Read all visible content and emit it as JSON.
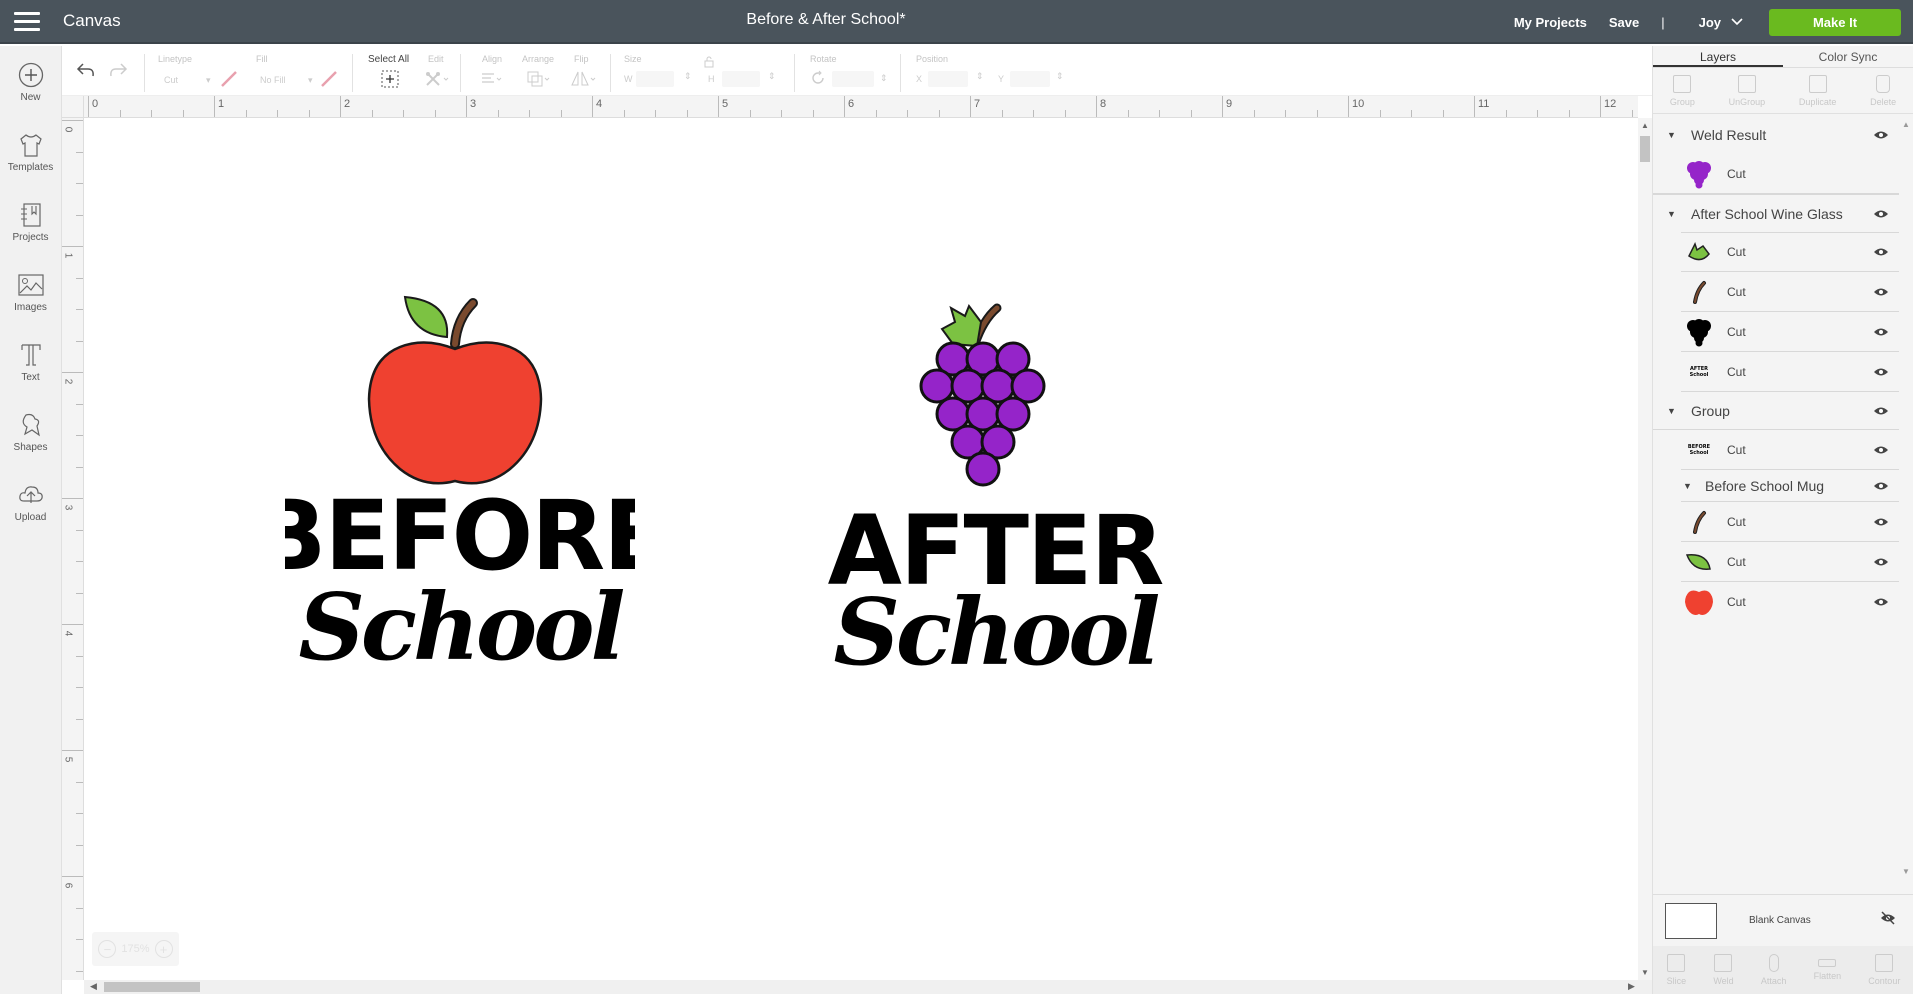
{
  "header": {
    "app_name": "Canvas",
    "document_title": "Before & After School*",
    "my_projects": "My Projects",
    "save": "Save",
    "separator": "|",
    "user": "Joy",
    "make_it": "Make It",
    "accent_color": "#6aba1f"
  },
  "left_nav": {
    "items": [
      {
        "label": "New",
        "icon": "plus-circle-icon"
      },
      {
        "label": "Templates",
        "icon": "tshirt-icon"
      },
      {
        "label": "Projects",
        "icon": "notebook-icon"
      },
      {
        "label": "Images",
        "icon": "image-icon"
      },
      {
        "label": "Text",
        "icon": "text-icon"
      },
      {
        "label": "Shapes",
        "icon": "shapes-icon"
      },
      {
        "label": "Upload",
        "icon": "cloud-upload-icon"
      }
    ]
  },
  "toolbar": {
    "linetype_label": "Linetype",
    "linetype_value": "Cut",
    "fill_label": "Fill",
    "fill_value": "No Fill",
    "select_all": "Select All",
    "edit": "Edit",
    "align": "Align",
    "arrange": "Arrange",
    "flip": "Flip",
    "size": "Size",
    "w": "W",
    "h": "H",
    "rotate": "Rotate",
    "position": "Position",
    "x": "X",
    "y": "Y"
  },
  "rulers": {
    "horizontal": [
      "0",
      "1",
      "2",
      "3",
      "4",
      "5",
      "6",
      "7",
      "8",
      "9",
      "10",
      "11",
      "12"
    ],
    "vertical": [
      "0",
      "1",
      "2",
      "3",
      "4",
      "5",
      "6"
    ]
  },
  "canvas": {
    "zoom": "175%",
    "designs": [
      {
        "name": "Before School Mug",
        "line1": "Before",
        "line2": "School",
        "icon": "apple",
        "colors": {
          "fruit": "#ef4130",
          "leaf": "#7cc242",
          "stem": "#7a4a2e"
        }
      },
      {
        "name": "After School Wine Glass",
        "line1": "After",
        "line2": "School",
        "icon": "grapes",
        "colors": {
          "fruit": "#9524c9",
          "leaf": "#7cc242",
          "stem": "#7a4a2e"
        }
      }
    ]
  },
  "panel": {
    "tabs": [
      "Layers",
      "Color Sync"
    ],
    "active_tab": "Layers",
    "actions": [
      "Group",
      "UnGroup",
      "Duplicate",
      "Delete"
    ],
    "layers": [
      {
        "type": "group",
        "name": "Weld Result",
        "children": [
          {
            "thumb": "grapes-purple",
            "op": "Cut"
          }
        ]
      },
      {
        "type": "group",
        "name": "After School Wine Glass",
        "children": [
          {
            "thumb": "grape-leaf",
            "op": "Cut"
          },
          {
            "thumb": "stem",
            "op": "Cut"
          },
          {
            "thumb": "grapes-black",
            "op": "Cut"
          },
          {
            "thumb": "after-school-text",
            "op": "Cut"
          }
        ]
      },
      {
        "type": "group",
        "name": "Group",
        "children": [
          {
            "thumb": "before-school-text",
            "op": "Cut"
          },
          {
            "type": "group",
            "name": "Before School Mug",
            "children": [
              {
                "thumb": "stem",
                "op": "Cut"
              },
              {
                "thumb": "apple-leaf",
                "op": "Cut"
              },
              {
                "thumb": "apple",
                "op": "Cut"
              }
            ]
          }
        ]
      }
    ],
    "thumb_text": {
      "after": "AFTER School",
      "before": "BEFORE School"
    },
    "blank_canvas": "Blank Canvas",
    "bottom_actions": [
      "Slice",
      "Weld",
      "Attach",
      "Flatten",
      "Contour"
    ]
  }
}
